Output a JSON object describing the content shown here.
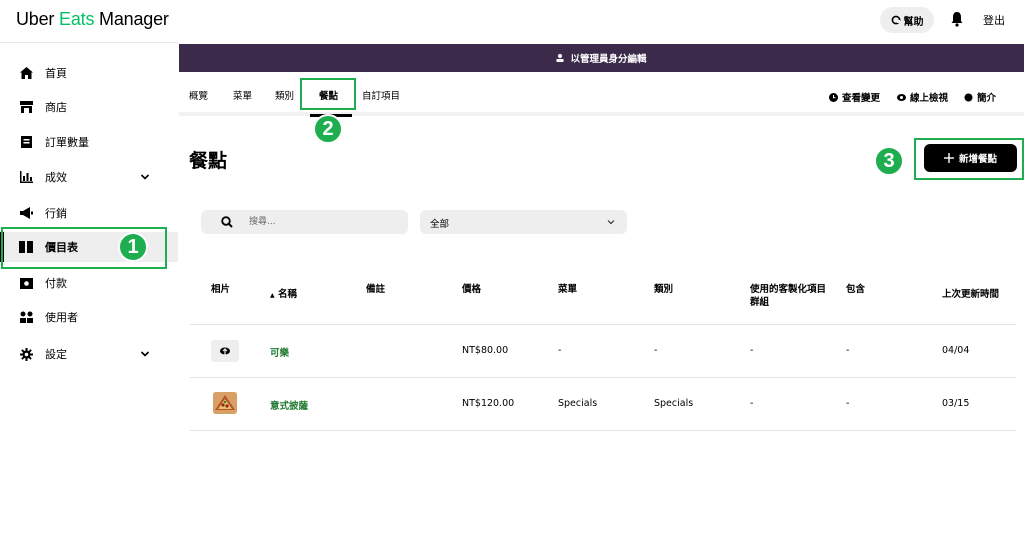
{
  "app": {
    "logo_part1": "Uber ",
    "logo_part2": "Eats",
    "logo_part3": " Manager"
  },
  "header": {
    "help_label": "幫助",
    "logout_label": "登出"
  },
  "sidebar": {
    "items": [
      {
        "label": "首頁",
        "icon": "home-icon"
      },
      {
        "label": "商店",
        "icon": "store-icon"
      },
      {
        "label": "訂單數量",
        "icon": "orders-icon"
      },
      {
        "label": "成效",
        "icon": "chart-icon"
      },
      {
        "label": "行銷",
        "icon": "megaphone-icon"
      },
      {
        "label": "價目表",
        "icon": "book-icon"
      },
      {
        "label": "付款",
        "icon": "payment-icon"
      },
      {
        "label": "使用者",
        "icon": "users-icon"
      },
      {
        "label": "設定",
        "icon": "gear-icon"
      }
    ],
    "active_index": 5
  },
  "banner": {
    "text": "以管理員身分編輯"
  },
  "tabs": [
    {
      "label": "概覽"
    },
    {
      "label": "菜單"
    },
    {
      "label": "類別"
    },
    {
      "label": "餐點"
    },
    {
      "label": "自訂項目"
    }
  ],
  "active_tab": 3,
  "tab_actions": {
    "history": "查看變更",
    "preview": "線上檢視",
    "intro": "簡介"
  },
  "page": {
    "title": "餐點",
    "add_button": "新增餐點"
  },
  "filters": {
    "search_placeholder": "搜尋...",
    "select_value": "全部"
  },
  "table": {
    "headers": {
      "photo": "相片",
      "name": "名稱",
      "note": "備註",
      "price": "價格",
      "menu": "菜單",
      "category": "類別",
      "custom_groups": "使用的客製化項目群組",
      "contains": "包含",
      "updated": "上次更新時間"
    },
    "rows": [
      {
        "name": "可樂",
        "price": "NT$80.00",
        "menu": "-",
        "category": "-",
        "custom": "-",
        "contains": "-",
        "updated": "04/04"
      },
      {
        "name": "意式披薩",
        "price": "NT$120.00",
        "menu": "Specials",
        "category": "Specials",
        "custom": "-",
        "contains": "-",
        "updated": "03/15"
      }
    ]
  },
  "annotations": {
    "badge1": "1",
    "badge2": "2",
    "badge3": "3"
  },
  "colors": {
    "accent": "#1fae4f",
    "banner": "#3b2a4a",
    "brand_green": "#06c167",
    "link": "#1d7a2f"
  }
}
